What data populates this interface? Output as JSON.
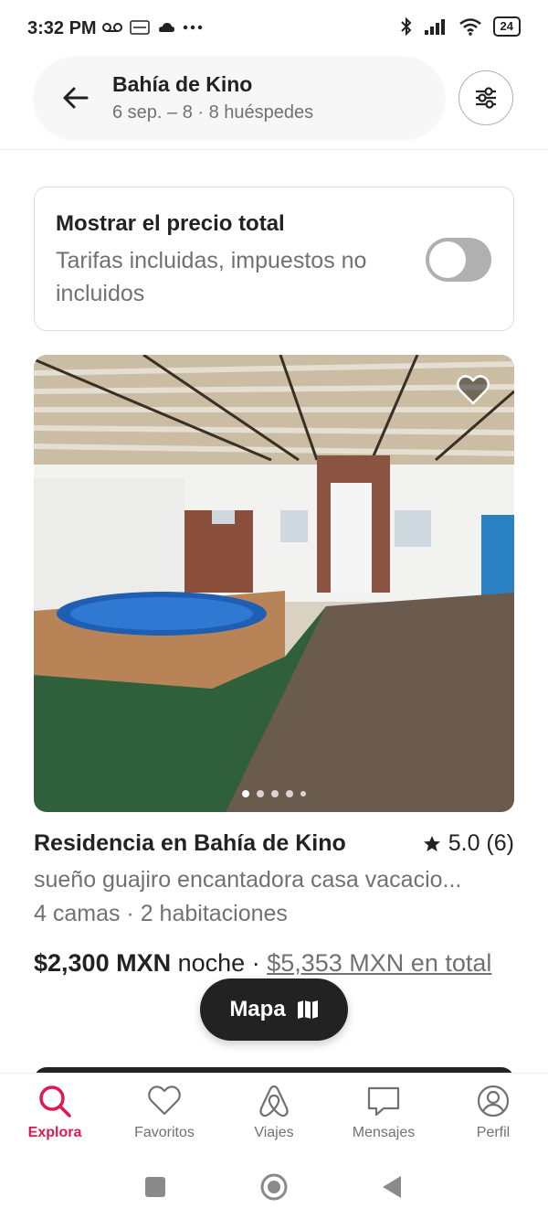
{
  "status_bar": {
    "time": "3:32 PM",
    "battery": "24",
    "left_icons": [
      "voicemail-icon",
      "temu-icon",
      "cloud-icon",
      "more-dots-icon"
    ],
    "right_icons": [
      "bluetooth-icon",
      "signal-icon",
      "wifi-icon",
      "battery-icon"
    ]
  },
  "search": {
    "title": "Bahía de Kino",
    "subtitle": "6 sep. – 8 · 8 huéspedes"
  },
  "price_toggle": {
    "title": "Mostrar el precio total",
    "subtitle": "Tarifas incluidas, impuestos no incluidos",
    "enabled": false
  },
  "listing": {
    "photo_count": 5,
    "active_photo": 1,
    "title": "Residencia en Bahía de Kino",
    "rating": "5.0 (6)",
    "description": "sueño guajiro  encantadora casa vacacio...",
    "meta": "4 camas · 2 habitaciones",
    "price": "$2,300 MXN",
    "price_unit": "noche",
    "price_separator": "·",
    "total": "$5,353 MXN en total"
  },
  "map_button": {
    "label": "Mapa"
  },
  "tabs": [
    {
      "label": "Explora",
      "icon": "search-icon",
      "active": true
    },
    {
      "label": "Favoritos",
      "icon": "heart-icon",
      "active": false
    },
    {
      "label": "Viajes",
      "icon": "airbnb-logo-icon",
      "active": false
    },
    {
      "label": "Mensajes",
      "icon": "message-icon",
      "active": false
    },
    {
      "label": "Perfil",
      "icon": "profile-icon",
      "active": false
    }
  ],
  "colors": {
    "accent": "#e0184f",
    "text": "#222222",
    "muted": "#717171"
  }
}
